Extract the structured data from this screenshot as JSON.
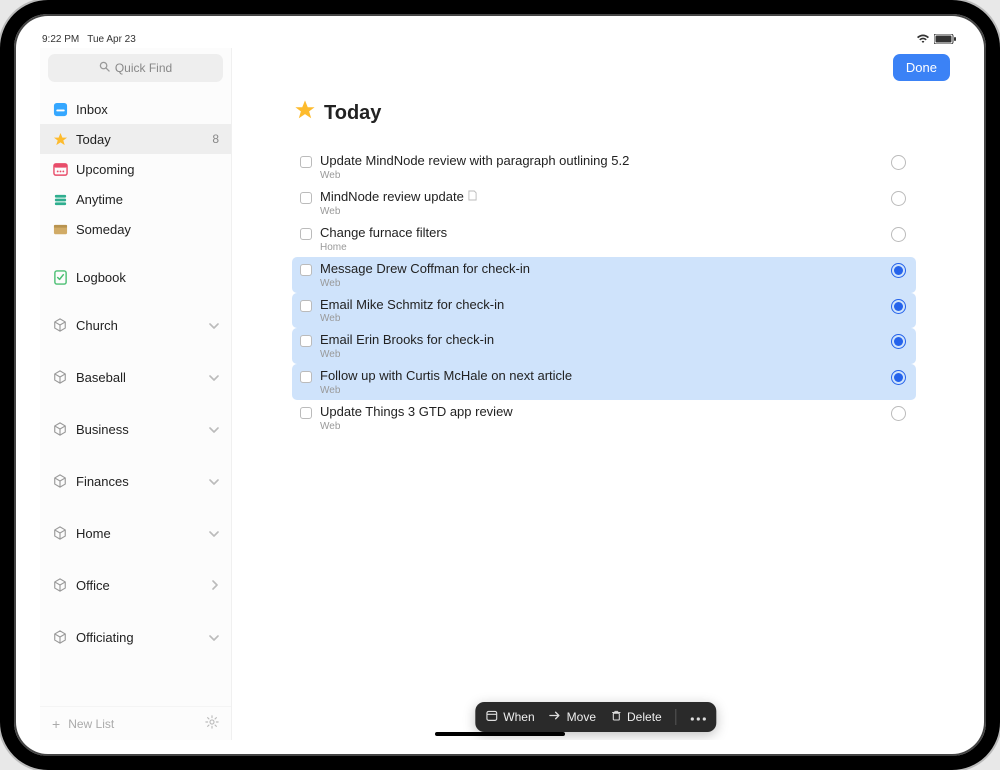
{
  "status": {
    "time": "9:22 PM",
    "date": "Tue Apr 23"
  },
  "sidebar": {
    "quickfind": "Quick Find",
    "top": [
      {
        "id": "inbox",
        "label": "Inbox",
        "icon": "inbox"
      },
      {
        "id": "today",
        "label": "Today",
        "icon": "star",
        "badge": "8",
        "selected": true
      },
      {
        "id": "upcoming",
        "label": "Upcoming",
        "icon": "calendar"
      },
      {
        "id": "anytime",
        "label": "Anytime",
        "icon": "stack"
      },
      {
        "id": "someday",
        "label": "Someday",
        "icon": "archive"
      }
    ],
    "logbook": {
      "label": "Logbook"
    },
    "areas": [
      {
        "label": "Church",
        "chev": "down"
      },
      {
        "label": "Baseball",
        "chev": "down"
      },
      {
        "label": "Business",
        "chev": "down"
      },
      {
        "label": "Finances",
        "chev": "down"
      },
      {
        "label": "Home",
        "chev": "down"
      },
      {
        "label": "Office",
        "chev": "right"
      },
      {
        "label": "Officiating",
        "chev": "down"
      }
    ],
    "newlist": "New List"
  },
  "header": {
    "done": "Done"
  },
  "page": {
    "title": "Today"
  },
  "tasks": [
    {
      "title": "Update MindNode review with paragraph outlining 5.2",
      "project": "Web",
      "selected": false,
      "note": false
    },
    {
      "title": "MindNode review update",
      "project": "Web",
      "selected": false,
      "note": true
    },
    {
      "title": "Change furnace filters",
      "project": "Home",
      "selected": false,
      "note": false
    },
    {
      "title": "Message Drew Coffman for check-in",
      "project": "Web",
      "selected": true,
      "note": false
    },
    {
      "title": "Email Mike Schmitz for check-in",
      "project": "Web",
      "selected": true,
      "note": false
    },
    {
      "title": "Email Erin Brooks for check-in",
      "project": "Web",
      "selected": true,
      "note": false
    },
    {
      "title": "Follow up with Curtis McHale on next article",
      "project": "Web",
      "selected": true,
      "note": false
    },
    {
      "title": "Update Things 3 GTD app review",
      "project": "Web",
      "selected": false,
      "note": false
    }
  ],
  "actionbar": {
    "when": "When",
    "move": "Move",
    "delete": "Delete"
  }
}
